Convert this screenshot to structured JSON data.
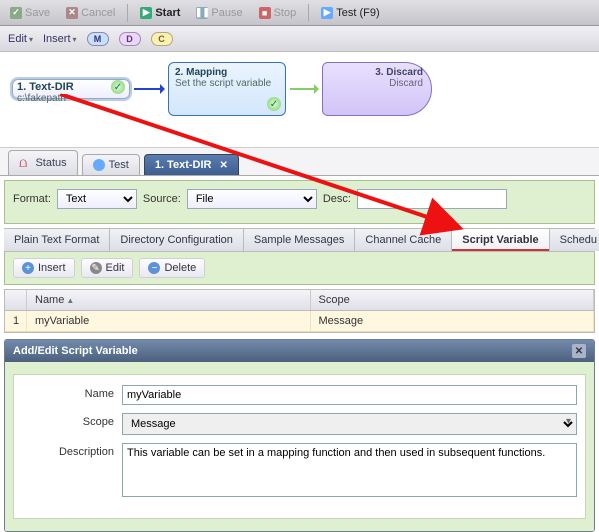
{
  "toolbar": {
    "save": "Save",
    "cancel": "Cancel",
    "start": "Start",
    "pause": "Pause",
    "stop": "Stop",
    "test": "Test (F9)"
  },
  "toolbar2": {
    "edit": "Edit",
    "insert": "Insert",
    "m": "M",
    "d": "D",
    "c": "C"
  },
  "flow": {
    "n1_t": "1. Text-DIR",
    "n1_s": "c:\\fakepath",
    "n2_t": "2. Mapping",
    "n2_s": "Set the script variable",
    "n3_t": "3. Discard",
    "n3_s": "Discard"
  },
  "tabs1": {
    "status": "Status",
    "test": "Test",
    "textdir": "1. Text-DIR"
  },
  "form": {
    "format_lbl": "Format:",
    "format_val": "Text",
    "source_lbl": "Source:",
    "source_val": "File",
    "desc_lbl": "Desc:",
    "desc_val": ""
  },
  "tabs2": {
    "plain": "Plain Text Format",
    "dir": "Directory Configuration",
    "sample": "Sample Messages",
    "cache": "Channel Cache",
    "script": "Script Variable",
    "sched": "Schedu"
  },
  "toolbar3": {
    "insert": "Insert",
    "edit": "Edit",
    "delete": "Delete"
  },
  "grid": {
    "col_name": "Name",
    "col_scope": "Scope",
    "row_num": "1",
    "row_name": "myVariable",
    "row_scope": "Message"
  },
  "dialog": {
    "title": "Add/Edit Script Variable",
    "name_lbl": "Name",
    "name_val": "myVariable",
    "scope_lbl": "Scope",
    "scope_val": "Message",
    "desc_lbl": "Description",
    "desc_val": "This variable can be set in a mapping function and then used in subsequent functions."
  }
}
